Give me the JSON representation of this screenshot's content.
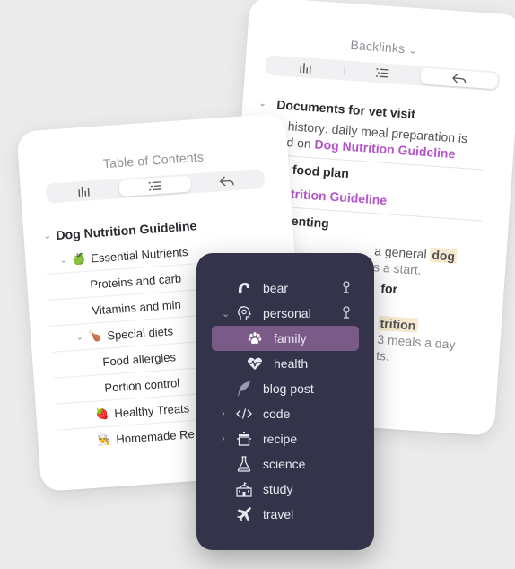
{
  "backlinks": {
    "title": "Backlinks",
    "title_chevron": "⌄",
    "sections": [
      {
        "heading": "Documents for vet visit",
        "text_prefix": "history: daily meal preparation is",
        "text_line2_prefix": "d on ",
        "link": "Dog Nutrition Guideline"
      },
      {
        "heading": ": food plan",
        "link": "utrition Guideline"
      },
      {
        "heading": "renting",
        "text_prefix": "a general ",
        "highlight": "dog",
        "text_line2": "s a start."
      },
      {
        "heading": "for"
      },
      {
        "highlight": "trition",
        "text_line1": "3 meals a day",
        "text_line2": "ts."
      }
    ]
  },
  "toc": {
    "title": "Table of Contents",
    "items": [
      {
        "label": "Dog Nutrition Guideline",
        "level": 0,
        "expanded": true
      },
      {
        "label": "Essential Nutrients",
        "level": 1,
        "expanded": true,
        "emoji": "🍏"
      },
      {
        "label": "Proteins and carb",
        "level": 2
      },
      {
        "label": "Vitamins and min",
        "level": 2
      },
      {
        "label": "Special diets",
        "level": 1,
        "expanded": true,
        "emoji": "🍗"
      },
      {
        "label": "Food allergies",
        "level": 2
      },
      {
        "label": "Portion control",
        "level": 2
      },
      {
        "label": "Healthy Treats",
        "level": 1,
        "emoji": "🍓"
      },
      {
        "label": "Homemade Re",
        "level": 1,
        "emoji": "👨‍🍳"
      }
    ]
  },
  "menu": {
    "items": [
      {
        "label": "bear",
        "icon": "bear-paw-arc-icon",
        "pin": true
      },
      {
        "label": "personal",
        "icon": "head-profile-icon",
        "pin": true,
        "expanded": true
      },
      {
        "label": "family",
        "icon": "paw-icon",
        "selected": true
      },
      {
        "label": "health",
        "icon": "heart-pulse-icon"
      },
      {
        "label": "blog post",
        "icon": "feather-icon"
      },
      {
        "label": "code",
        "icon": "code-brackets-icon",
        "collapsed": true
      },
      {
        "label": "recipe",
        "icon": "pot-icon",
        "collapsed": true
      },
      {
        "label": "science",
        "icon": "flask-icon"
      },
      {
        "label": "study",
        "icon": "school-building-icon"
      },
      {
        "label": "travel",
        "icon": "airplane-icon"
      }
    ],
    "colors": {
      "background": "#33334a",
      "selected": "#7a5b88",
      "text": "#e9e9f2"
    }
  }
}
